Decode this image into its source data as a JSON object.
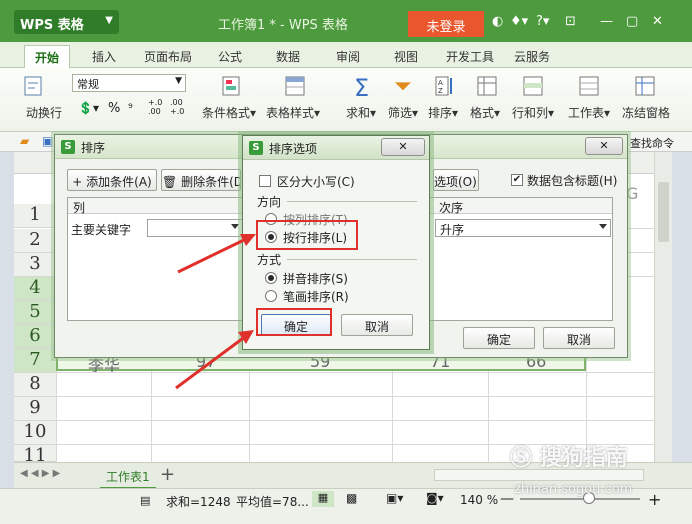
{
  "app": {
    "name": "WPS 表格",
    "doc_title": "工作簿1 * - WPS 表格",
    "login": "未登录",
    "help": "?"
  },
  "tabs": [
    "开始",
    "插入",
    "页面布局",
    "公式",
    "数据",
    "审阅",
    "视图",
    "开发工具",
    "云服务"
  ],
  "ribbon": {
    "format_value": "常规",
    "wrap": "动换行",
    "cond_format": "条件格式",
    "table_style": "表格样式",
    "sum": "求和",
    "filter": "筛选",
    "sort": "排序",
    "format": "格式",
    "rowcol": "行和列",
    "sheet": "工作表",
    "freeze": "冻结窗格",
    "percent": "%",
    "dec_inc": "+.0 .00",
    "dec_dec": ".00 +.0",
    "find_cmd": "查找命令"
  },
  "grid": {
    "rows": [
      "1",
      "2",
      "3",
      "4",
      "5",
      "6",
      "7",
      "8",
      "9",
      "10",
      "11"
    ],
    "col_g": "G",
    "row7_values": [
      "李华",
      "97",
      "59",
      "71",
      "66"
    ]
  },
  "sheetbar": {
    "sheet_name": "工作表1",
    "add": "+"
  },
  "status": {
    "sum": "求和=1248",
    "avg": "平均值=78...",
    "zoom": "140 %"
  },
  "sort_dialog": {
    "title": "排序",
    "add_condition": "添加条件(A)",
    "delete_condition": "删除条件(D)",
    "options_btn": "选项(O)...",
    "header_checkbox": "数据包含标题(H)",
    "col_header": "列",
    "order_header": "次序",
    "primary_key": "主要关键字",
    "order_value": "升序",
    "ok": "确定",
    "cancel": "取消"
  },
  "options_dialog": {
    "title": "排序选项",
    "case_sensitive": "区分大小写(C)",
    "direction_label": "方向",
    "by_column": "按列排序(T)",
    "by_row": "按行排序(L)",
    "method_label": "方式",
    "pinyin": "拼音排序(S)",
    "stroke": "笔画排序(R)",
    "ok": "确定",
    "cancel": "取消",
    "close": "✕"
  },
  "watermark": {
    "text": "搜狗指南",
    "url": "zhinan.sogou.com"
  },
  "colors": {
    "brand_green": "#4e9a3e",
    "login_orange": "#e8572e",
    "highlight_red": "#e0302c"
  }
}
